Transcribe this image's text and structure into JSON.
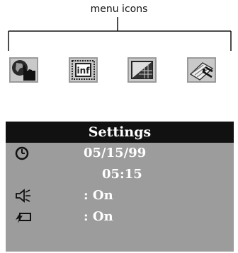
{
  "callout": {
    "label": "menu icons"
  },
  "menu_icons": [
    {
      "name": "image-select-icon"
    },
    {
      "name": "info-display-icon"
    },
    {
      "name": "image-format-icon"
    },
    {
      "name": "delete-icon"
    }
  ],
  "settings": {
    "title": "Settings",
    "rows": [
      {
        "icon": "clock-icon",
        "value": "05/15/99"
      },
      {
        "icon": "",
        "value": "05:15"
      },
      {
        "icon": "speaker-icon",
        "value": ": On"
      },
      {
        "icon": "power-save-icon",
        "value": ": On"
      }
    ]
  }
}
